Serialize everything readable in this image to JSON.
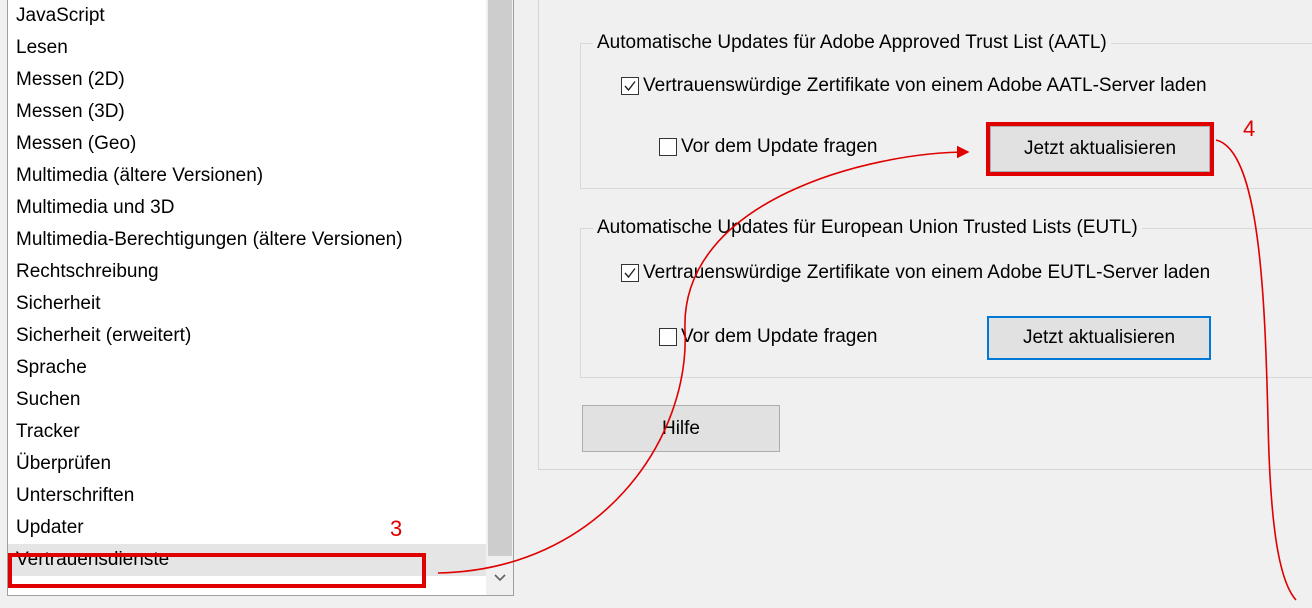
{
  "categories": {
    "items": [
      {
        "label": "JavaScript"
      },
      {
        "label": "Lesen"
      },
      {
        "label": "Messen (2D)"
      },
      {
        "label": "Messen (3D)"
      },
      {
        "label": "Messen (Geo)"
      },
      {
        "label": "Multimedia (ältere Versionen)"
      },
      {
        "label": "Multimedia und 3D"
      },
      {
        "label": "Multimedia-Berechtigungen (ältere Versionen)"
      },
      {
        "label": "Rechtschreibung"
      },
      {
        "label": "Sicherheit"
      },
      {
        "label": "Sicherheit (erweitert)"
      },
      {
        "label": "Sprache"
      },
      {
        "label": "Suchen"
      },
      {
        "label": "Tracker"
      },
      {
        "label": "Überprüfen"
      },
      {
        "label": "Unterschriften"
      },
      {
        "label": "Updater"
      },
      {
        "label": "Vertrauensdienste"
      }
    ],
    "selected": "Vertrauensdienste",
    "scroll_icon": "chevron-down-icon"
  },
  "aatl": {
    "legend": "Automatische Updates für Adobe Approved Trust List (AATL)",
    "load_label": "Vertrauenswürdige Zertifikate von einem Adobe AATL-Server laden",
    "load_checked": true,
    "ask_label": "Vor dem Update fragen",
    "ask_checked": false,
    "update_button": "Jetzt aktualisieren"
  },
  "eutl": {
    "legend": "Automatische Updates für European Union Trusted Lists (EUTL)",
    "load_label": "Vertrauenswürdige Zertifikate von einem Adobe EUTL-Server laden",
    "load_checked": true,
    "ask_label": "Vor dem Update fragen",
    "ask_checked": false,
    "update_button": "Jetzt aktualisieren"
  },
  "help_button": "Hilfe",
  "annotations": {
    "step3": "3",
    "step4": "4",
    "color": "#e00000"
  },
  "colors": {
    "background": "#f0f0f0",
    "list_background": "#ffffff",
    "selection": "#e5e5e5",
    "button": "#e1e1e1",
    "focus": "#0078d7"
  }
}
